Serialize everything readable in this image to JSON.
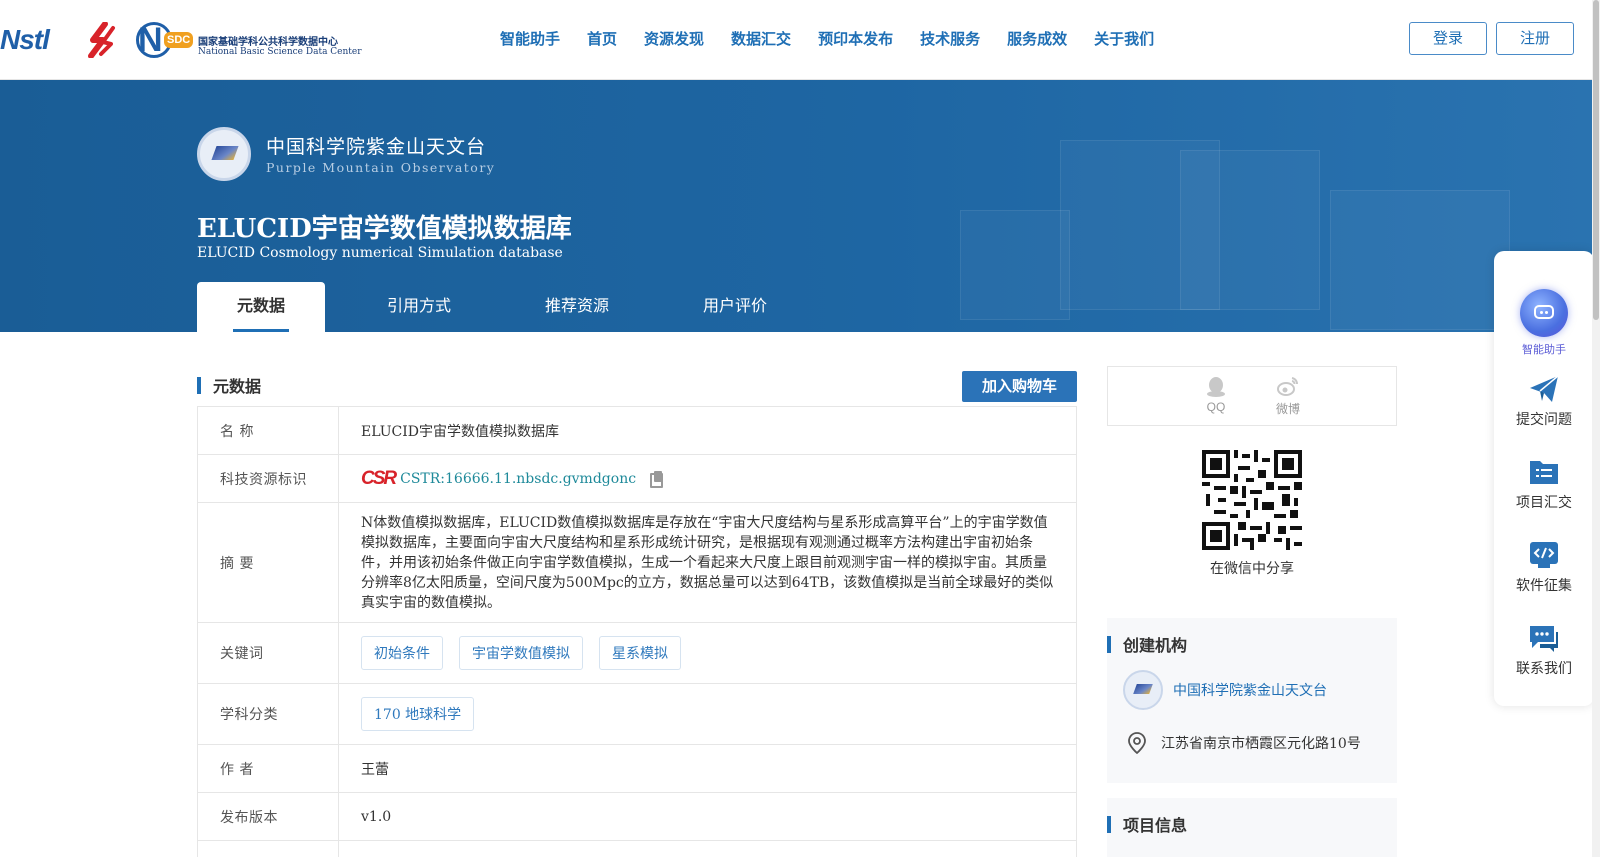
{
  "header": {
    "logo_nstl": "Nstl",
    "logo_nsdc_cn": "国家基础学科公共科学数据中心",
    "logo_nsdc_en": "National Basic Science Data Center",
    "logo_nsdc_badge": "SDC",
    "nav": [
      "智能助手",
      "首页",
      "资源发现",
      "数据汇交",
      "预印本发布",
      "技术服务",
      "服务成效",
      "关于我们"
    ],
    "login": "登录",
    "register": "注册"
  },
  "banner": {
    "org_cn": "中国科学院紫金山天文台",
    "org_en": "Purple Mountain Observatory",
    "title": "ELUCID宇宙学数值模拟数据库",
    "subtitle": "ELUCID Cosmology numerical Simulation database",
    "tabs": [
      "元数据",
      "引用方式",
      "推荐资源",
      "用户评价"
    ]
  },
  "metadata": {
    "section_title": "元数据",
    "cart_button": "加入购物车",
    "rows": {
      "name_label": "名 称",
      "name_value": "ELUCID宇宙学数值模拟数据库",
      "cstr_label": "科技资源标识",
      "cstr_logo": "CSR",
      "cstr_value": "CSTR:16666.11.nbsdc.gvmdgonc",
      "abstract_label": "摘 要",
      "abstract_value": "N体数值模拟数据库，ELUCID数值模拟数据库是存放在“宇宙大尺度结构与星系形成高算平台”上的宇宙学数值模拟数据库，主要面向宇宙大尺度结构和星系形成统计研究，是根据现有观测通过概率方法构建出宇宙初始条件，并用该初始条件做正向宇宙学数值模拟，生成一个看起来大尺度上跟目前观测宇宙一样的模拟宇宙。其质量分辨率8亿太阳质量，空间尺度为500Mpc的立方，数据总量可以达到64TB，该数值模拟是当前全球最好的类似真实宇宙的数值模拟。",
      "keywords_label": "关键词",
      "keywords": [
        "初始条件",
        "宇宙学数值模拟",
        "星系模拟"
      ],
      "subject_label": "学科分类",
      "subjects": [
        "170 地球科学"
      ],
      "author_label": "作 者",
      "author_value": "王蕾",
      "version_label": "发布版本",
      "version_value": "v1.0"
    }
  },
  "sidebar": {
    "share_qq": "QQ",
    "share_weibo": "微博",
    "wechat_share": "在微信中分享",
    "creator_title": "创建机构",
    "creator_org": "中国科学院紫金山天文台",
    "creator_address": "江苏省南京市栖霞区元化路10号",
    "project_title": "项目信息"
  },
  "float_toolbar": {
    "ai": "智能助手",
    "submit": "提交问题",
    "project": "项目汇交",
    "software": "软件征集",
    "contact": "联系我们"
  },
  "colors": {
    "primary": "#1f6fb5",
    "banner": "#1e66a3",
    "cart_button": "#2b73b8",
    "cstr_red": "#d8232a"
  }
}
